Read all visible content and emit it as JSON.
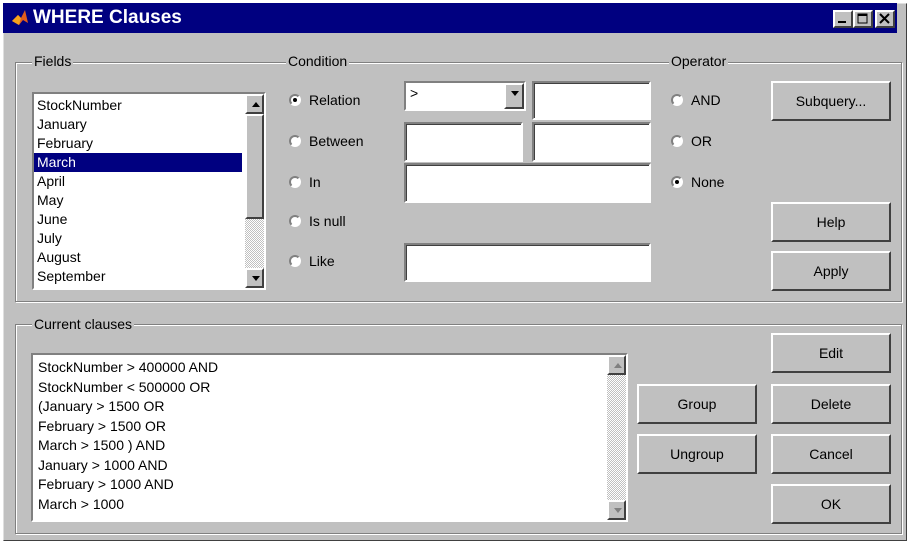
{
  "window": {
    "title": "WHERE Clauses"
  },
  "fields": {
    "label": "Fields",
    "items": [
      "StockNumber",
      "January",
      "February",
      "March",
      "April",
      "May",
      "June",
      "July",
      "August",
      "September"
    ],
    "selected_index": 3
  },
  "condition": {
    "label": "Condition",
    "relation_label": "Relation",
    "between_label": "Between",
    "in_label": "In",
    "isnull_label": "Is null",
    "like_label": "Like",
    "relation_value": ">",
    "selected": "Relation"
  },
  "operator": {
    "label": "Operator",
    "and_label": "AND",
    "or_label": "OR",
    "none_label": "None",
    "selected": "None"
  },
  "buttons": {
    "subquery": "Subquery...",
    "help": "Help",
    "apply": "Apply",
    "edit": "Edit",
    "group": "Group",
    "delete": "Delete",
    "ungroup": "Ungroup",
    "cancel": "Cancel",
    "ok": "OK"
  },
  "current_clauses": {
    "label": "Current clauses",
    "lines": [
      "StockNumber > 400000  AND",
      "StockNumber < 500000  OR",
      "(January > 1500  OR",
      "February > 1500  OR",
      "March > 1500  ) AND",
      "January > 1000  AND",
      "February > 1000  AND",
      "March > 1000"
    ]
  },
  "icons": {
    "app": "matlab-icon",
    "minimize": "minimize-icon",
    "maximize": "maximize-icon",
    "close": "close-icon"
  }
}
